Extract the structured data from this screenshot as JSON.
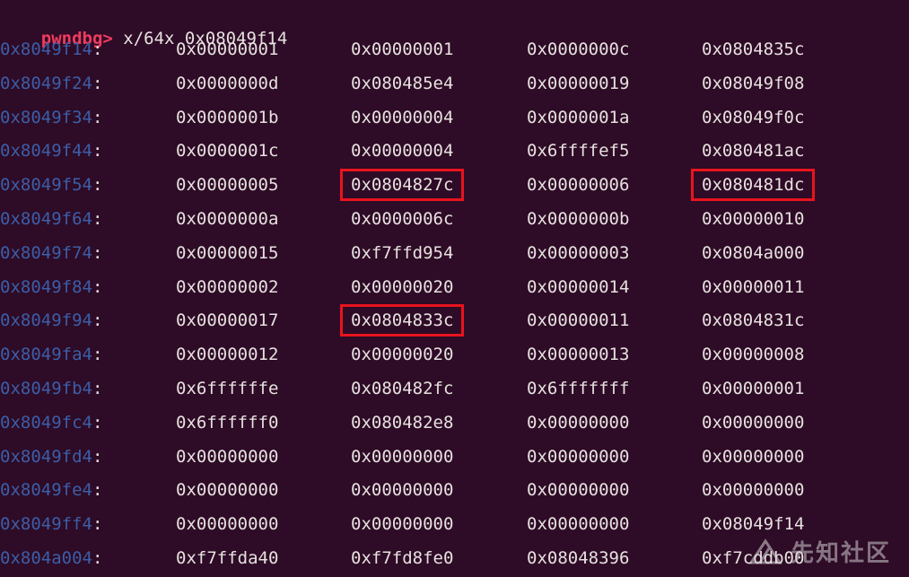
{
  "prompt": {
    "label": "pwndbg>",
    "command": " x/64x 0x08049f14"
  },
  "rows": [
    {
      "addr": "0x8049f14",
      "words": [
        "0x00000001",
        "0x00000001",
        "0x0000000c",
        "0x0804835c"
      ]
    },
    {
      "addr": "0x8049f24",
      "words": [
        "0x0000000d",
        "0x080485e4",
        "0x00000019",
        "0x08049f08"
      ]
    },
    {
      "addr": "0x8049f34",
      "words": [
        "0x0000001b",
        "0x00000004",
        "0x0000001a",
        "0x08049f0c"
      ]
    },
    {
      "addr": "0x8049f44",
      "words": [
        "0x0000001c",
        "0x00000004",
        "0x6ffffef5",
        "0x080481ac"
      ]
    },
    {
      "addr": "0x8049f54",
      "words": [
        "0x00000005",
        "0x0804827c",
        "0x00000006",
        "0x080481dc"
      ]
    },
    {
      "addr": "0x8049f64",
      "words": [
        "0x0000000a",
        "0x0000006c",
        "0x0000000b",
        "0x00000010"
      ]
    },
    {
      "addr": "0x8049f74",
      "words": [
        "0x00000015",
        "0xf7ffd954",
        "0x00000003",
        "0x0804a000"
      ]
    },
    {
      "addr": "0x8049f84",
      "words": [
        "0x00000002",
        "0x00000020",
        "0x00000014",
        "0x00000011"
      ]
    },
    {
      "addr": "0x8049f94",
      "words": [
        "0x00000017",
        "0x0804833c",
        "0x00000011",
        "0x0804831c"
      ]
    },
    {
      "addr": "0x8049fa4",
      "words": [
        "0x00000012",
        "0x00000020",
        "0x00000013",
        "0x00000008"
      ]
    },
    {
      "addr": "0x8049fb4",
      "words": [
        "0x6ffffffe",
        "0x080482fc",
        "0x6fffffff",
        "0x00000001"
      ]
    },
    {
      "addr": "0x8049fc4",
      "words": [
        "0x6ffffff0",
        "0x080482e8",
        "0x00000000",
        "0x00000000"
      ]
    },
    {
      "addr": "0x8049fd4",
      "words": [
        "0x00000000",
        "0x00000000",
        "0x00000000",
        "0x00000000"
      ]
    },
    {
      "addr": "0x8049fe4",
      "words": [
        "0x00000000",
        "0x00000000",
        "0x00000000",
        "0x00000000"
      ]
    },
    {
      "addr": "0x8049ff4",
      "words": [
        "0x00000000",
        "0x00000000",
        "0x00000000",
        "0x08049f14"
      ]
    },
    {
      "addr": "0x804a004",
      "words": [
        "0xf7ffda40",
        "0xf7fd8fe0",
        "0x08048396",
        "0xf7cddb00"
      ]
    }
  ],
  "highlights": [
    "0x0804827c",
    "0x080481dc",
    "0x0804833c"
  ],
  "colors": {
    "background": "#2e0b26",
    "prompt": "#ef3b5e",
    "address": "#3c5ea8",
    "text": "#e6e1df",
    "highlight_box": "#e8141e"
  },
  "watermark": {
    "text": "先知社区",
    "icon": "xianzhi-logo-icon"
  }
}
